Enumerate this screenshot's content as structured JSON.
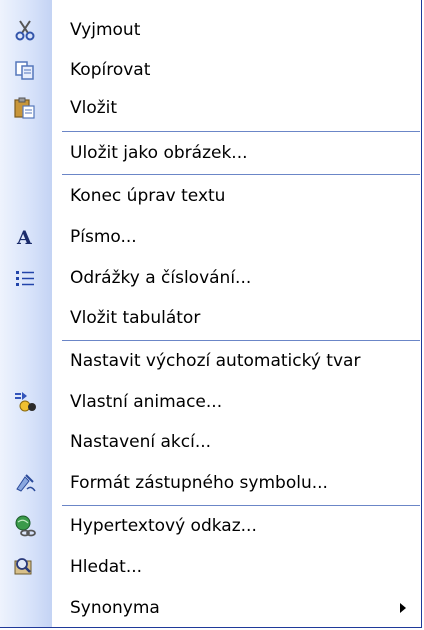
{
  "menu": {
    "items": [
      {
        "label": "Vyjmout",
        "icon": "cut-icon"
      },
      {
        "label": "Kopírovat",
        "icon": "copy-icon"
      },
      {
        "label": "Vložit",
        "icon": "paste-icon"
      },
      {
        "label": "Uložit jako obrázek...",
        "icon": ""
      },
      {
        "label": "Konec úprav textu",
        "icon": ""
      },
      {
        "label": "Písmo...",
        "icon": "font-icon"
      },
      {
        "label": "Odrážky a číslování...",
        "icon": "bullets-icon"
      },
      {
        "label": "Vložit tabulátor",
        "icon": ""
      },
      {
        "label": "Nastavit výchozí automatický tvar",
        "icon": ""
      },
      {
        "label": "Vlastní animace...",
        "icon": "animation-icon"
      },
      {
        "label": "Nastavení akcí...",
        "icon": ""
      },
      {
        "label": "Formát zástupného symbolu...",
        "icon": "format-icon"
      },
      {
        "label": "Hypertextový odkaz...",
        "icon": "hyperlink-icon"
      },
      {
        "label": "Hledat...",
        "icon": "search-icon"
      },
      {
        "label": "Synonyma",
        "icon": "",
        "submenu": true
      }
    ]
  },
  "colors": {
    "separator": "#6b86c7",
    "gutter": "#d9e4fa",
    "border": "#1f3a9a"
  }
}
